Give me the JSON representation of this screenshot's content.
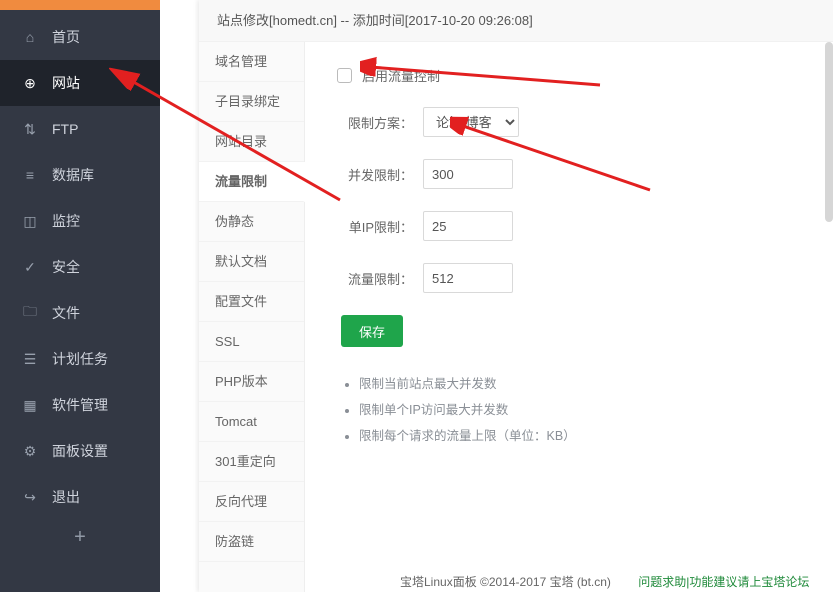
{
  "sidebar": {
    "items": [
      {
        "label": "首页",
        "icon": "⌂"
      },
      {
        "label": "网站",
        "icon": "⊕",
        "active": true
      },
      {
        "label": "FTP",
        "icon": "⇅"
      },
      {
        "label": "数据库",
        "icon": "≡"
      },
      {
        "label": "监控",
        "icon": "◫"
      },
      {
        "label": "安全",
        "icon": "✓"
      },
      {
        "label": "文件",
        "icon": "🗀"
      },
      {
        "label": "计划任务",
        "icon": "☰"
      },
      {
        "label": "软件管理",
        "icon": "▦"
      },
      {
        "label": "面板设置",
        "icon": "⚙"
      },
      {
        "label": "退出",
        "icon": "↪"
      }
    ],
    "plus": "+"
  },
  "modal": {
    "title": "站点修改[homedt.cn] -- 添加时间[2017-10-20 09:26:08]",
    "tabs": [
      "域名管理",
      "子目录绑定",
      "网站目录",
      "流量限制",
      "伪静态",
      "默认文档",
      "配置文件",
      "SSL",
      "PHP版本",
      "Tomcat",
      "301重定向",
      "反向代理",
      "防盗链"
    ],
    "active_tab_index": 3
  },
  "form": {
    "enable_label": "启用流量控制",
    "scheme_label": "限制方案：",
    "scheme_value": "论坛/博客",
    "concurrency_label": "并发限制：",
    "concurrency_value": "300",
    "perip_label": "单IP限制：",
    "perip_value": "25",
    "traffic_label": "流量限制：",
    "traffic_value": "512",
    "save_label": "保存"
  },
  "hints": [
    "限制当前站点最大并发数",
    "限制单个IP访问最大并发数",
    "限制每个请求的流量上限（单位：KB）"
  ],
  "footer": {
    "left": "宝塔Linux面板 ©2014-2017 宝塔 (bt.cn)",
    "right": "问题求助|功能建议请上宝塔论坛"
  }
}
